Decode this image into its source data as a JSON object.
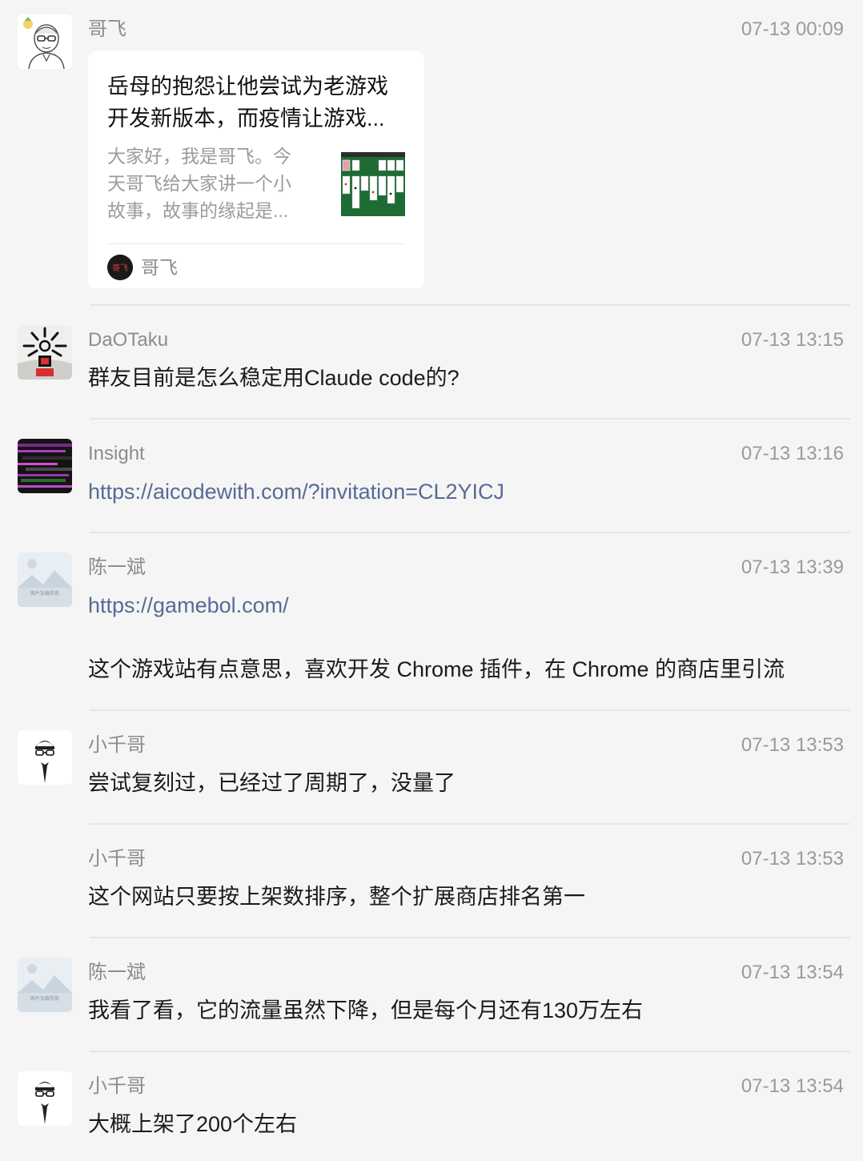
{
  "messages": [
    {
      "sender": "哥飞",
      "time": "07-13 00:09",
      "card": {
        "title_lines": [
          "岳母的抱怨让他尝试为老游戏",
          "开发新版本，而疫情让游戏..."
        ],
        "desc_lines": [
          "大家好，我是哥飞。今",
          "天哥飞给大家讲一个小",
          "故事，故事的缘起是..."
        ],
        "source": "哥飞",
        "source_icon_text": "哥飞"
      }
    },
    {
      "sender": "DaOTaku",
      "time": "07-13 13:15",
      "text": "群友目前是怎么稳定用Claude code的?"
    },
    {
      "sender": "Insight",
      "time": "07-13 13:16",
      "link": "https://aicodewith.com/?invitation=CL2YICJ"
    },
    {
      "sender": "陈一斌",
      "time": "07-13 13:39",
      "link": "https://gamebol.com/",
      "text": "这个游戏站有点意思，喜欢开发 Chrome 插件，在 Chrome 的商店里引流",
      "avatar_caption": "图片加载失败"
    },
    {
      "sender": "小千哥",
      "time": "07-13 13:53",
      "text": "尝试复刻过，已经过了周期了，没量了"
    },
    {
      "sender": "小千哥",
      "time": "07-13 13:53",
      "text": "这个网站只要按上架数排序，整个扩展商店排名第一"
    },
    {
      "sender": "陈一斌",
      "time": "07-13 13:54",
      "text": "我看了看，它的流量虽然下降，但是每个月还有130万左右",
      "avatar_caption": "图片加载失败"
    },
    {
      "sender": "小千哥",
      "time": "07-13 13:54",
      "text": "大概上架了200个左右"
    }
  ],
  "colors": {
    "background": "#f5f5f5",
    "link": "#576b95",
    "meta_text": "#8c8c8c",
    "body_text": "#1b1b1b"
  },
  "icons": {
    "avatar_0": "cartoon-man-with-glasses-avatar",
    "avatar_1": "starburst-face-avatar",
    "avatar_2": "glitch-stripes-avatar",
    "avatar_3": "image-placeholder-avatar",
    "avatar_4": "man-in-suit-avatar",
    "card_thumb": "solitaire-cards-thumbnail"
  }
}
